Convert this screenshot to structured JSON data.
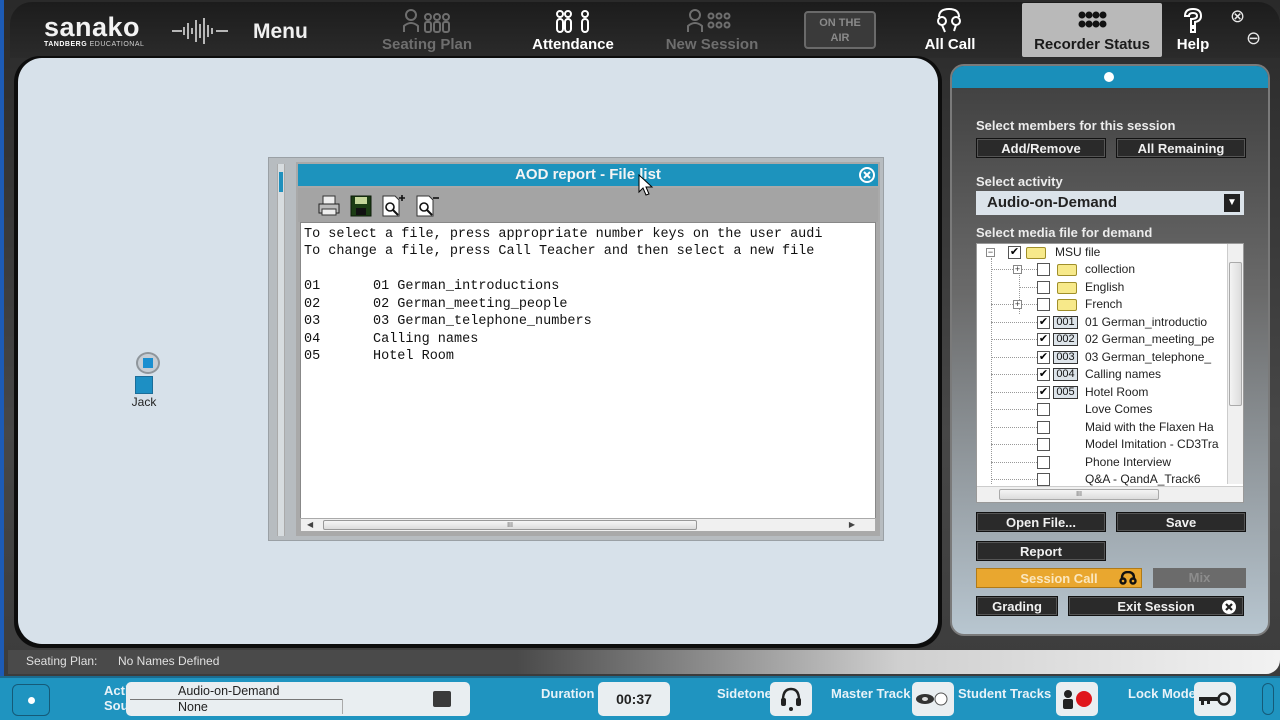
{
  "topbar": {
    "brand": "sanako",
    "brand_sub_bold": "TANDBERG",
    "brand_sub": "EDUCATIONAL",
    "menu_label": "Menu",
    "nav": [
      {
        "label": "Seating Plan",
        "icon": "seating-plan-icon",
        "state": "disabled"
      },
      {
        "label": "Attendance",
        "icon": "attendance-icon",
        "state": "enabled"
      },
      {
        "label": "New Session",
        "icon": "new-session-icon",
        "state": "disabled"
      },
      {
        "label": "All Call",
        "icon": "all-call-icon",
        "state": "enabled"
      },
      {
        "label": "Recorder Status",
        "icon": "recorder-status-icon",
        "state": "active"
      },
      {
        "label": "Help",
        "icon": "help-icon",
        "state": "enabled"
      }
    ],
    "on_air_line1": "ON THE",
    "on_air_line2": "AIR",
    "close_glyph": "⊗",
    "minimize_glyph": "⊖"
  },
  "canvas": {
    "students": [
      {
        "name": "Jack"
      }
    ]
  },
  "dialog": {
    "title": "AOD report - File list",
    "toolbar": [
      "print-icon",
      "save-icon",
      "zoom-in-icon",
      "zoom-out-icon"
    ],
    "instructions": [
      "To select a file, press appropriate number keys on the user audi",
      "To change a file, press Call Teacher and then select a new file"
    ],
    "files": [
      {
        "key": "01",
        "name": "01 German_introductions"
      },
      {
        "key": "02",
        "name": "02 German_meeting_people"
      },
      {
        "key": "03",
        "name": "03 German_telephone_numbers"
      },
      {
        "key": "04",
        "name": "Calling names"
      },
      {
        "key": "05",
        "name": "Hotel Room"
      }
    ],
    "scroll_grip": "III"
  },
  "panel": {
    "members_label": "Select members for this session",
    "add_remove": "Add/Remove",
    "all_remaining": "All Remaining",
    "activity_label": "Select activity",
    "activity_value": "Audio-on-Demand",
    "media_label": "Select media file for demand",
    "tree": {
      "root": {
        "label": "MSU file",
        "checked": true
      },
      "folders": [
        {
          "label": "collection",
          "checked": false,
          "expandable": true
        },
        {
          "label": "English",
          "checked": false,
          "expandable": false
        },
        {
          "label": "French",
          "checked": false,
          "expandable": true
        }
      ],
      "files": [
        {
          "badge": "001",
          "label": "01 German_introductio",
          "checked": true
        },
        {
          "badge": "002",
          "label": "02 German_meeting_pe",
          "checked": true
        },
        {
          "badge": "003",
          "label": "03 German_telephone_",
          "checked": true
        },
        {
          "badge": "004",
          "label": "Calling names",
          "checked": true
        },
        {
          "badge": "005",
          "label": "Hotel Room",
          "checked": true
        },
        {
          "badge": "",
          "label": "Love Comes",
          "checked": false
        },
        {
          "badge": "",
          "label": "Maid with the Flaxen Ha",
          "checked": false
        },
        {
          "badge": "",
          "label": "Model Imitation - CD3Tra",
          "checked": false
        },
        {
          "badge": "",
          "label": "Phone Interview",
          "checked": false
        },
        {
          "badge": "",
          "label": "Q&A - QandA_Track6",
          "checked": false
        }
      ],
      "scroll_grip": "III"
    },
    "open_file": "Open File...",
    "save": "Save",
    "report": "Report",
    "session_call": "Session Call",
    "mix": "Mix",
    "grading": "Grading",
    "exit_session": "Exit Session"
  },
  "status": {
    "seating_plan_label": "Seating Plan:",
    "seating_plan_value": "No Names Defined"
  },
  "footer": {
    "activity_label": "Activity",
    "source_label": "Source",
    "activity_value": "Audio-on-Demand",
    "source_value": "None",
    "duration_label": "Duration",
    "duration_value": "00:37",
    "sidetone_label": "Sidetone",
    "master_track_label": "Master Track",
    "student_tracks_label": "Student Tracks",
    "lock_mode_label": "Lock Mode",
    "colors": {
      "accent": "#1f94c0",
      "record": "#e0161c",
      "session_call": "#e9a72f"
    }
  }
}
